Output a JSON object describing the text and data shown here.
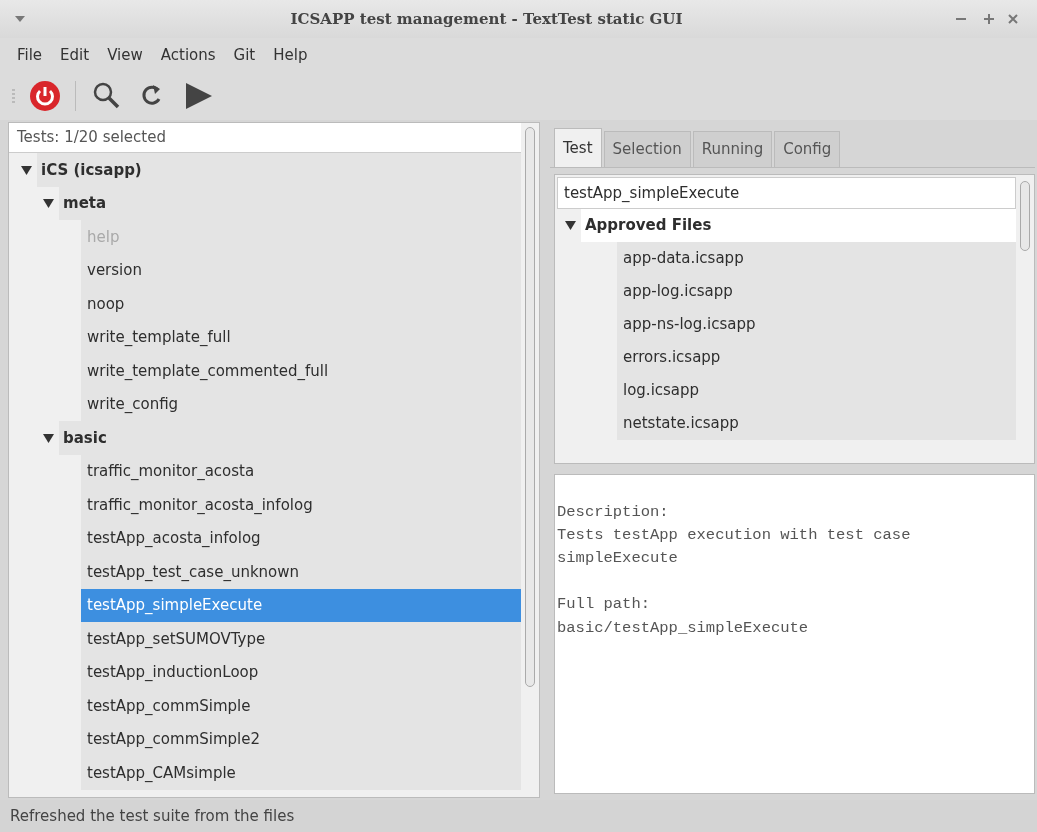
{
  "window": {
    "title": "ICSAPP test management - TextTest static GUI"
  },
  "menu": [
    "File",
    "Edit",
    "View",
    "Actions",
    "Git",
    "Help"
  ],
  "toolbar": [
    {
      "kind": "quit"
    },
    {
      "kind": "search"
    },
    {
      "kind": "refresh"
    },
    {
      "kind": "run"
    }
  ],
  "tests_panel": {
    "header": "Tests: 1/20 selected",
    "tree": [
      {
        "label": "iCS (icsapp)",
        "expanded": true,
        "children": [
          {
            "label": "meta",
            "expanded": true,
            "children": [
              {
                "label": "help",
                "disabled": true,
                "selected": false
              },
              {
                "label": "version",
                "disabled": false,
                "selected": false
              },
              {
                "label": "noop",
                "disabled": false,
                "selected": false
              },
              {
                "label": "write_template_full",
                "disabled": false,
                "selected": false
              },
              {
                "label": "write_template_commented_full",
                "disabled": false,
                "selected": false
              },
              {
                "label": "write_config",
                "disabled": false,
                "selected": false
              }
            ]
          },
          {
            "label": "basic",
            "expanded": true,
            "children": [
              {
                "label": "traffic_monitor_acosta",
                "disabled": false,
                "selected": false
              },
              {
                "label": "traffic_monitor_acosta_infolog",
                "disabled": false,
                "selected": false
              },
              {
                "label": "testApp_acosta_infolog",
                "disabled": false,
                "selected": false
              },
              {
                "label": "testApp_test_case_unknown",
                "disabled": false,
                "selected": false
              },
              {
                "label": "testApp_simpleExecute",
                "disabled": false,
                "selected": true
              },
              {
                "label": "testApp_setSUMOVType",
                "disabled": false,
                "selected": false
              },
              {
                "label": "testApp_inductionLoop",
                "disabled": false,
                "selected": false
              },
              {
                "label": "testApp_commSimple",
                "disabled": false,
                "selected": false
              },
              {
                "label": "testApp_commSimple2",
                "disabled": false,
                "selected": false
              },
              {
                "label": "testApp_CAMsimple",
                "disabled": false,
                "selected": false
              }
            ]
          }
        ]
      }
    ]
  },
  "tabs": [
    {
      "label": "Test",
      "selected": true
    },
    {
      "label": "Selection",
      "selected": false
    },
    {
      "label": "Running",
      "selected": false
    },
    {
      "label": "Config",
      "selected": false
    }
  ],
  "test_name": "testApp_simpleExecute",
  "files_tree": [
    {
      "label": "Approved Files",
      "expanded": true,
      "children": [
        {
          "label": "app-data.icsapp"
        },
        {
          "label": "app-log.icsapp"
        },
        {
          "label": "app-ns-log.icsapp"
        },
        {
          "label": "errors.icsapp"
        },
        {
          "label": "log.icsapp"
        },
        {
          "label": "netstate.icsapp"
        }
      ]
    }
  ],
  "info_blocks": [
    [
      "Description:",
      "Tests testApp execution with test case",
      "simpleExecute"
    ],
    [
      "Full path:",
      "basic/testApp_simpleExecute"
    ]
  ],
  "status_bar": "Refreshed the test suite from the files"
}
